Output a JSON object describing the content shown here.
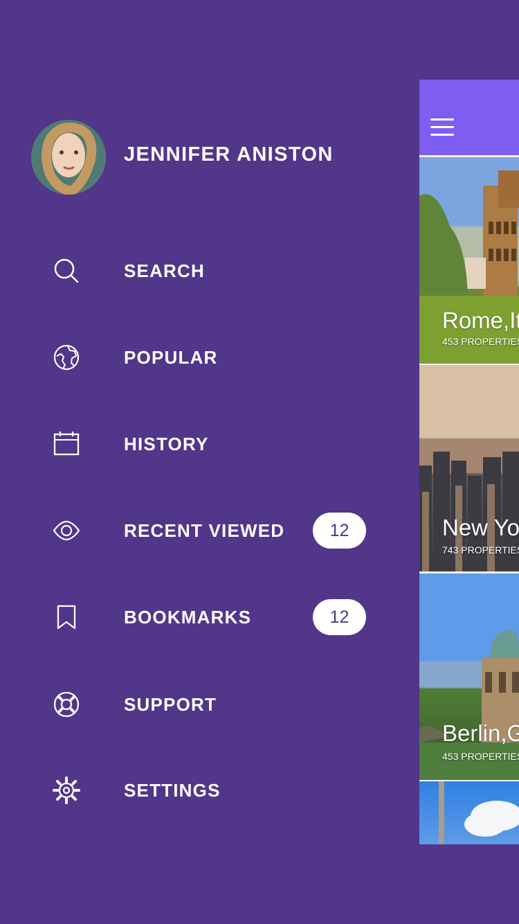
{
  "user": {
    "name": "JENNIFER ANISTON"
  },
  "menu": [
    {
      "icon": "search-icon",
      "label": "SEARCH"
    },
    {
      "icon": "globe-icon",
      "label": "POPULAR"
    },
    {
      "icon": "calendar-icon",
      "label": "HISTORY"
    },
    {
      "icon": "eye-icon",
      "label": "RECENT VIEWED",
      "badge": "12"
    },
    {
      "icon": "bookmark-icon",
      "label": "BOOKMARKS",
      "badge": "12"
    },
    {
      "icon": "lifebuoy-icon",
      "label": "SUPPORT"
    },
    {
      "icon": "gear-icon",
      "label": "SETTINGS"
    }
  ],
  "cities": [
    {
      "name": "Rome,Ita",
      "properties": "453 PROPERTIES"
    },
    {
      "name": "New Yor",
      "properties": "743 PROPERTIES"
    },
    {
      "name": "Berlin,Ge",
      "properties": "453 PROPERTIES"
    }
  ],
  "colors": {
    "background": "#51368a",
    "header": "#7d5ef0",
    "badge_text": "#51368a",
    "text": "#ffffff"
  }
}
